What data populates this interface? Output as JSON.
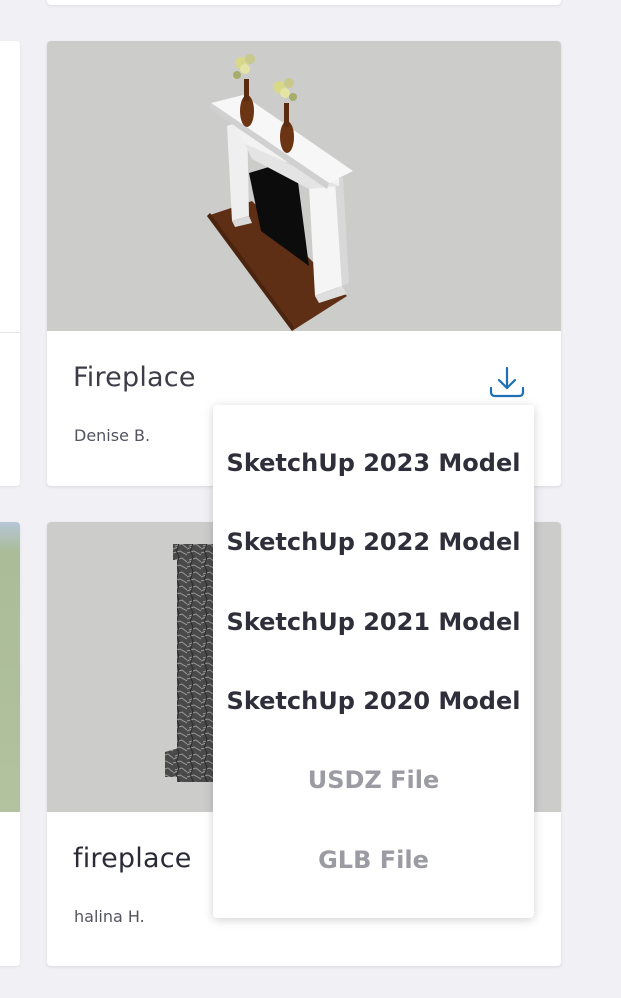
{
  "cards": [
    {
      "title": "Fireplace",
      "author": "Denise B.",
      "thumbnail": "white-mantel-fireplace-with-vases",
      "download_icon": "download-icon"
    },
    {
      "title": "fireplace",
      "author": "halina H.",
      "thumbnail": "dark-marble-fireplace",
      "download_icon": "download-icon"
    }
  ],
  "download_menu": {
    "items": [
      {
        "label": "SketchUp 2023 Model",
        "enabled": true
      },
      {
        "label": "SketchUp 2022 Model",
        "enabled": true
      },
      {
        "label": "SketchUp 2021 Model",
        "enabled": true
      },
      {
        "label": "SketchUp 2020 Model",
        "enabled": true
      },
      {
        "label": "USDZ File",
        "enabled": false
      },
      {
        "label": "GLB File",
        "enabled": false
      }
    ]
  },
  "colors": {
    "accent": "#1e6fb5",
    "background": "#f1f1f5",
    "thumbnail_bg": "#cccccb",
    "text_primary": "#2f2f3b",
    "text_disabled": "#9b9ba3"
  }
}
